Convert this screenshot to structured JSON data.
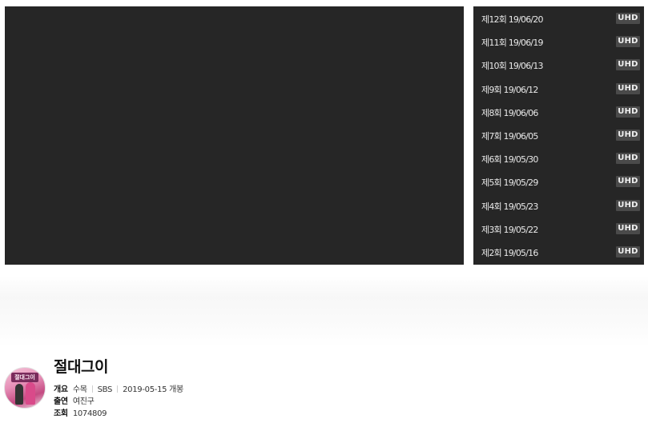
{
  "episodes": [
    {
      "label": "제12회 19/06/20",
      "badge": "UHD"
    },
    {
      "label": "제11회 19/06/19",
      "badge": "UHD"
    },
    {
      "label": "제10회 19/06/13",
      "badge": "UHD"
    },
    {
      "label": "제9회 19/06/12",
      "badge": "UHD"
    },
    {
      "label": "제8회 19/06/06",
      "badge": "UHD"
    },
    {
      "label": "제7회 19/06/05",
      "badge": "UHD"
    },
    {
      "label": "제6회 19/05/30",
      "badge": "UHD"
    },
    {
      "label": "제5회 19/05/29",
      "badge": "UHD"
    },
    {
      "label": "제4회 19/05/23",
      "badge": "UHD"
    },
    {
      "label": "제3회 19/05/22",
      "badge": "UHD"
    },
    {
      "label": "제2회 19/05/16",
      "badge": "UHD"
    }
  ],
  "show": {
    "title": "절대그이",
    "overview_key": "개요",
    "day": "수목",
    "channel": "SBS",
    "premiere": "2019-05-15 개봉",
    "cast_key": "출연",
    "cast": "여진구",
    "views_key": "조회",
    "views": "1074809",
    "poster_title": "절대그이"
  },
  "colors": {
    "panel": "#262626",
    "badge": "#4a4a4a"
  }
}
